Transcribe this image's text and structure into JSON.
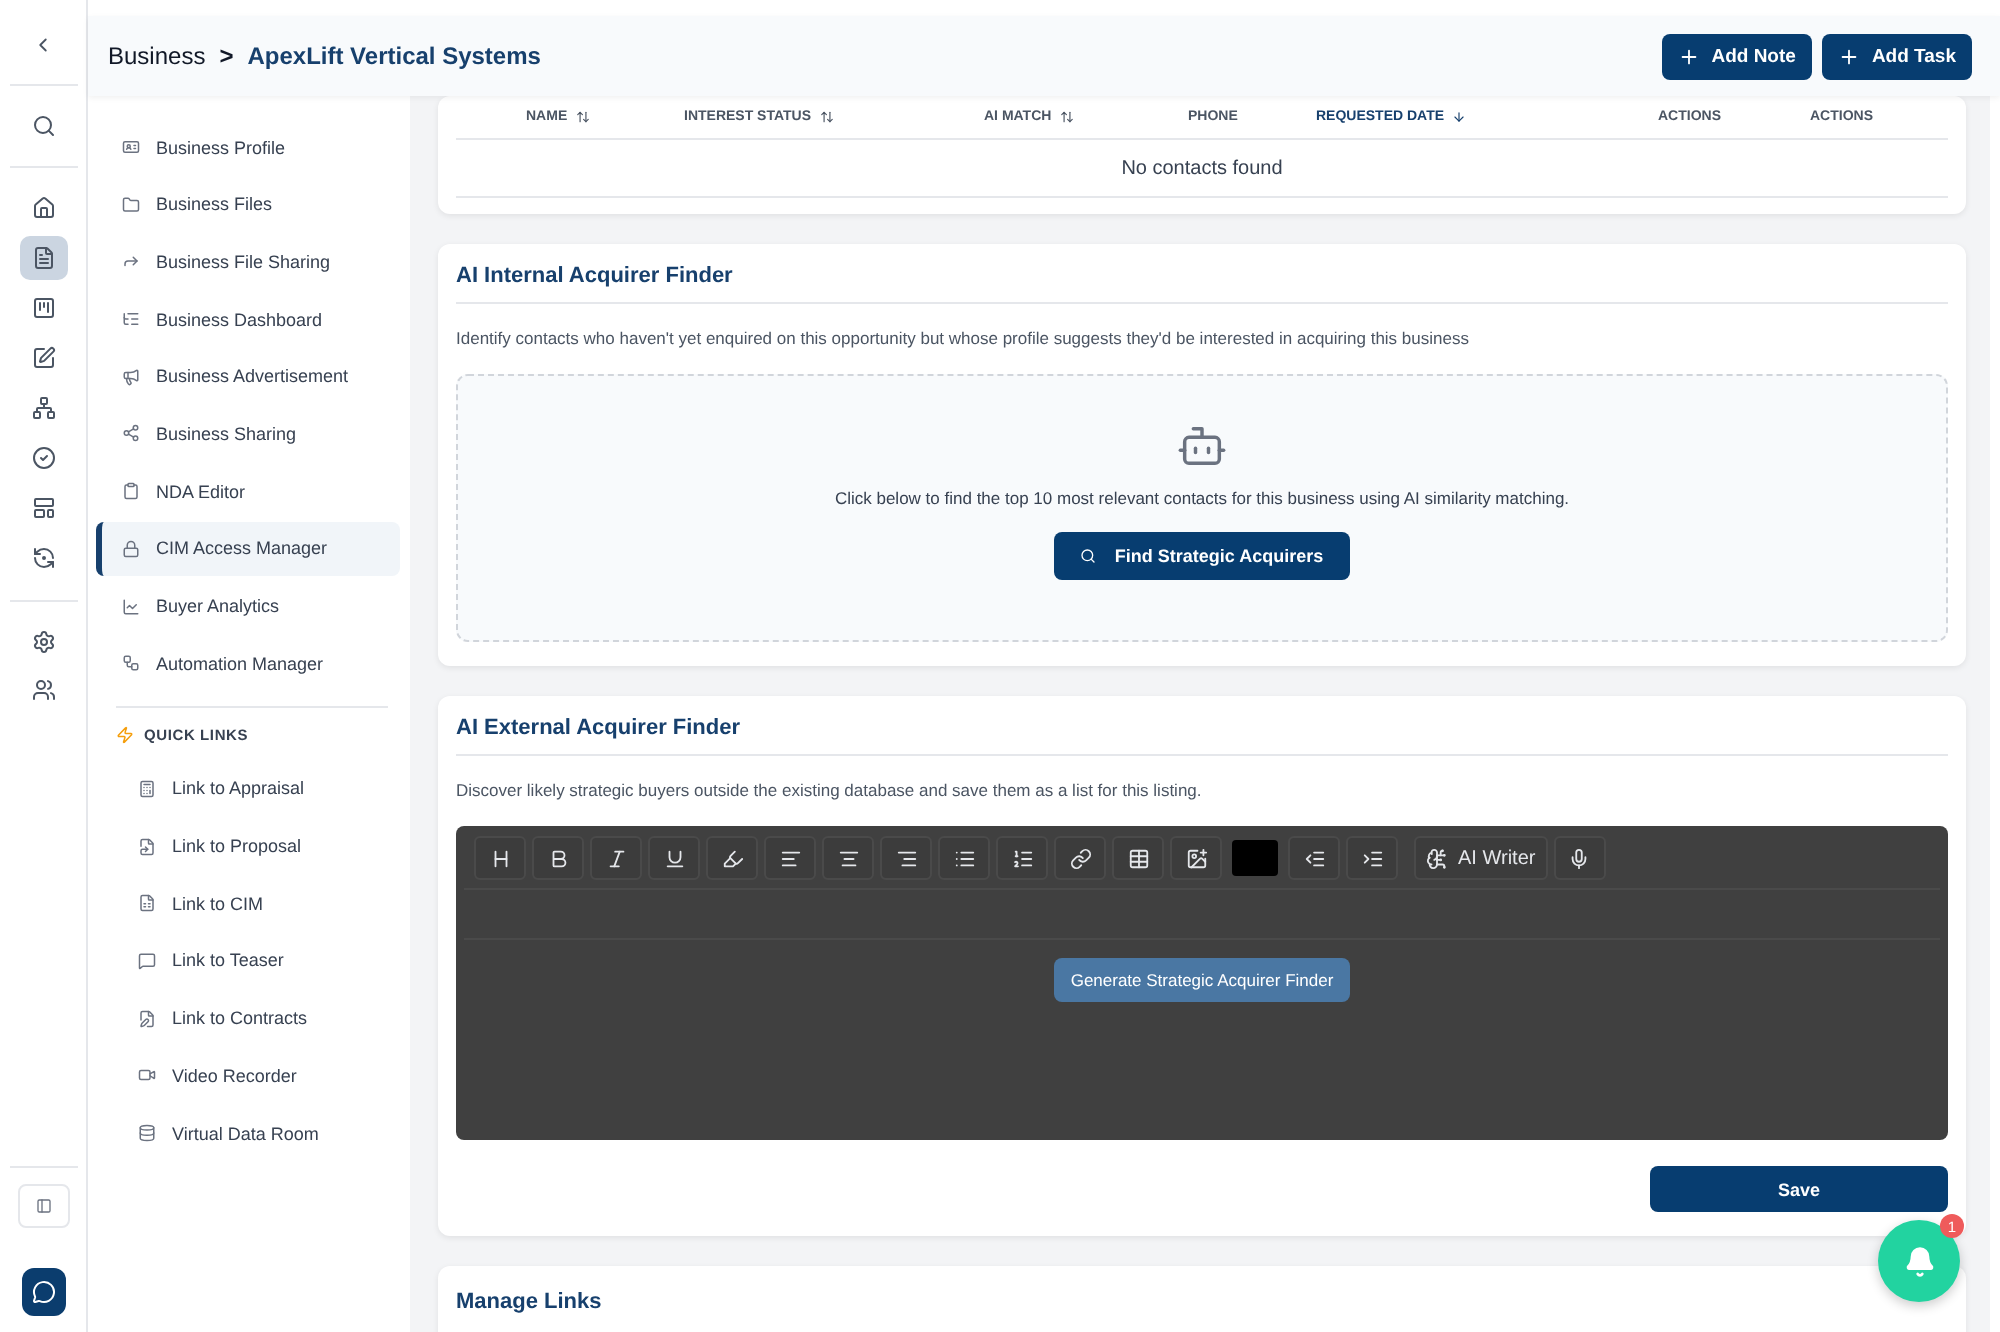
{
  "rail": {
    "items": [
      {
        "selected": false
      },
      {
        "selected": true
      },
      {
        "selected": false
      },
      {
        "selected": false
      },
      {
        "selected": false
      },
      {
        "selected": false
      },
      {
        "selected": false
      },
      {
        "selected": false
      },
      {
        "selected": false
      },
      {
        "selected": false
      }
    ]
  },
  "header": {
    "breadcrumb": [
      "Business",
      "ApexLift Vertical Systems"
    ],
    "separator": ">",
    "buttons": [
      "Add Note",
      "Add Task"
    ]
  },
  "sidebar": {
    "items": [
      {
        "label": "Business Profile",
        "selected": false
      },
      {
        "label": "Business Files",
        "selected": false
      },
      {
        "label": "Business File Sharing",
        "selected": false
      },
      {
        "label": "Business Dashboard",
        "selected": false
      },
      {
        "label": "Business Advertisement",
        "selected": false
      },
      {
        "label": "Business Sharing",
        "selected": false
      },
      {
        "label": "NDA Editor",
        "selected": false
      },
      {
        "label": "CIM Access Manager",
        "selected": true
      },
      {
        "label": "Buyer Analytics",
        "selected": false
      },
      {
        "label": "Automation Manager",
        "selected": false
      }
    ],
    "quick_links_title": "QUICK LINKS",
    "quick_links": [
      "Link to Appraisal",
      "Link to Proposal",
      "Link to CIM",
      "Link to Teaser",
      "Link to Contracts",
      "Video Recorder",
      "Virtual Data Room"
    ]
  },
  "contacts_table": {
    "columns": [
      {
        "label": "NAME",
        "kind": "sortable"
      },
      {
        "label": "INTEREST STATUS",
        "kind": "sortable"
      },
      {
        "label": "AI MATCH",
        "kind": "sortable"
      },
      {
        "label": "PHONE",
        "kind": "plain"
      },
      {
        "label": "REQUESTED DATE",
        "kind": "sorted"
      },
      {
        "label": "ACTIONS",
        "kind": "plain"
      },
      {
        "label": "ACTIONS",
        "kind": "plain"
      }
    ],
    "empty_message": "No contacts found"
  },
  "internal_finder": {
    "title": "AI Internal Acquirer Finder",
    "description": "Identify contacts who haven't yet enquired on this opportunity but whose profile suggests they'd be interested in acquiring this business",
    "prompt": "Click below to find the top 10 most relevant contacts for this business using AI similarity matching.",
    "button": "Find Strategic Acquirers"
  },
  "external_finder": {
    "title": "AI External Acquirer Finder",
    "description": "Discover likely strategic buyers outside the existing database and save them as a list for this listing.",
    "editor": {
      "color": "#000000",
      "ai_writer": "AI Writer",
      "generate_button": "Generate Strategic Acquirer Finder"
    },
    "save_button": "Save"
  },
  "manage_links": {
    "title": "Manage Links"
  },
  "notifications": {
    "count": "1"
  }
}
